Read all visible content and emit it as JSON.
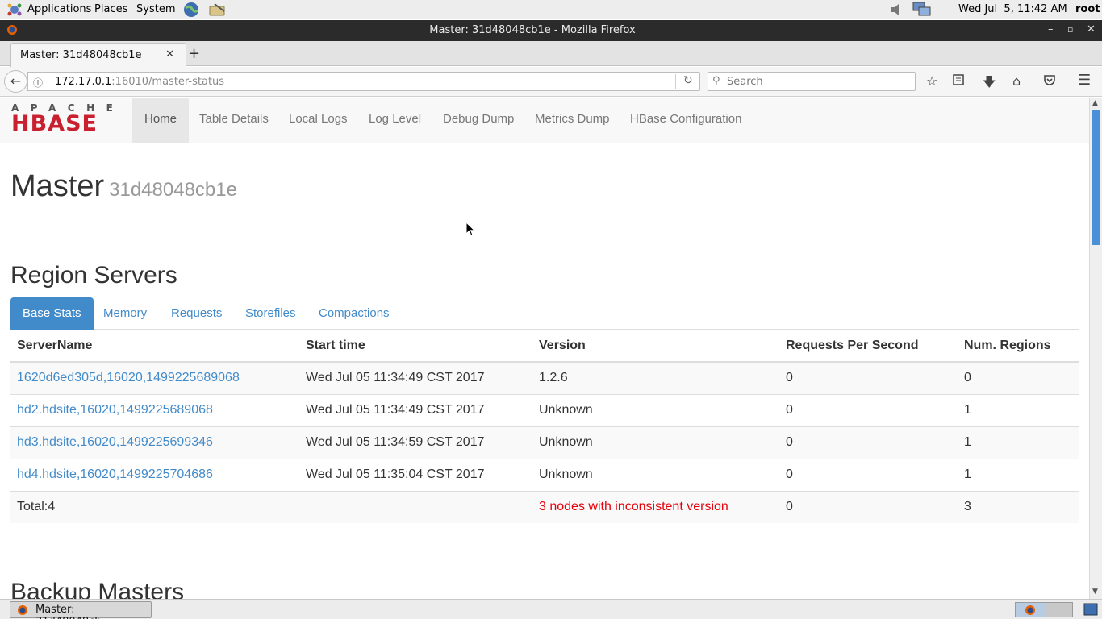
{
  "gnome_panel": {
    "menus": [
      "Applications",
      "Places",
      "System"
    ],
    "clock": "Wed Jul  5, 11:42 AM",
    "user": "root"
  },
  "firefox": {
    "window_title": "Master: 31d48048cb1e - Mozilla Firefox",
    "tab_title": "Master: 31d48048cb1e",
    "url_host": "172.17.0.1",
    "url_path": ":16010/master-status",
    "search_placeholder": "Search"
  },
  "hbase": {
    "logo_top": "APACHE",
    "logo_main": "HBASE",
    "nav": [
      "Home",
      "Table Details",
      "Local Logs",
      "Log Level",
      "Debug Dump",
      "Metrics Dump",
      "HBase Configuration"
    ],
    "master_label": "Master",
    "master_id": "31d48048cb1e",
    "region_servers_title": "Region Servers",
    "tabs": [
      "Base Stats",
      "Memory",
      "Requests",
      "Storefiles",
      "Compactions"
    ],
    "table": {
      "headers": [
        "ServerName",
        "Start time",
        "Version",
        "Requests Per Second",
        "Num. Regions"
      ],
      "rows": [
        [
          "1620d6ed305d,16020,1499225689068",
          "Wed Jul 05 11:34:49 CST 2017",
          "1.2.6",
          "0",
          "0"
        ],
        [
          "hd2.hdsite,16020,1499225689068",
          "Wed Jul 05 11:34:49 CST 2017",
          "Unknown",
          "0",
          "1"
        ],
        [
          "hd3.hdsite,16020,1499225699346",
          "Wed Jul 05 11:34:59 CST 2017",
          "Unknown",
          "0",
          "1"
        ],
        [
          "hd4.hdsite,16020,1499225704686",
          "Wed Jul 05 11:35:04 CST 2017",
          "Unknown",
          "0",
          "1"
        ]
      ],
      "total": [
        "Total:4",
        "",
        "3 nodes with inconsistent version",
        "0",
        "3"
      ]
    },
    "backup_masters_title": "Backup Masters"
  },
  "taskbar": {
    "item_label": "Master: 31d48048cb···"
  },
  "colors": {
    "link": "#428bca",
    "warning": "#e8000b",
    "hbase_red": "#c8202f"
  }
}
